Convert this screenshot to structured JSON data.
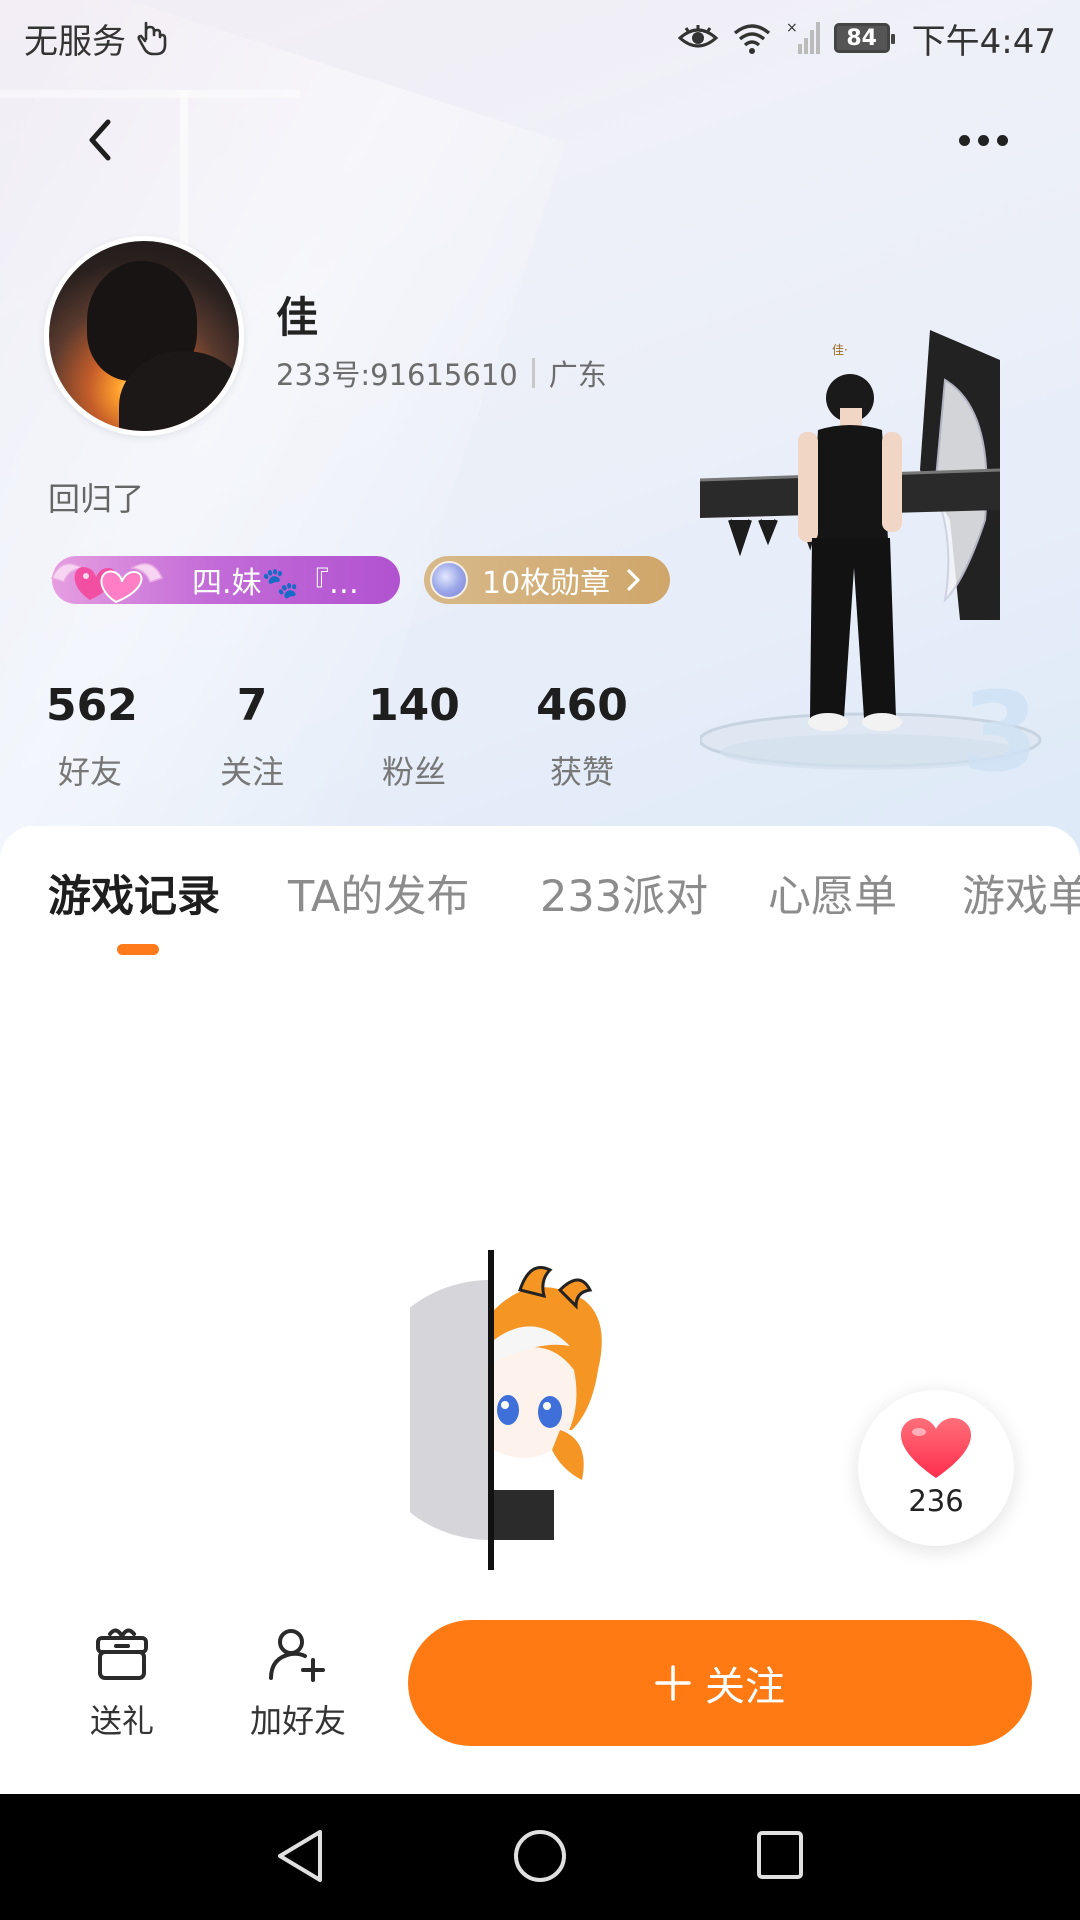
{
  "status_bar": {
    "carrier": "无服务",
    "battery": "84",
    "time": "下午4:47"
  },
  "profile": {
    "name": "佳",
    "id_text": "233号:91615610",
    "location": "广东",
    "bio": "回归了",
    "tag_label": "四.妹🐾『…",
    "medal_label": "10枚勋章"
  },
  "stats": [
    {
      "value": "562",
      "label": "好友"
    },
    {
      "value": "7",
      "label": "关注"
    },
    {
      "value": "140",
      "label": "粉丝"
    },
    {
      "value": "460",
      "label": "获赞"
    }
  ],
  "tabs": [
    {
      "label": "游戏记录",
      "active": true
    },
    {
      "label": "TA的发布",
      "active": false
    },
    {
      "label": "233派对",
      "active": false
    },
    {
      "label": "心愿单",
      "active": false
    },
    {
      "label": "游戏单",
      "active": false
    }
  ],
  "like": {
    "count": "236"
  },
  "actions": {
    "gift_label": "送礼",
    "add_friend_label": "加好友",
    "follow_label": "关注"
  },
  "colors": {
    "accent": "#ff7a12",
    "tag_purple": "#c36cd8",
    "medal_gold": "#cfa66a"
  }
}
